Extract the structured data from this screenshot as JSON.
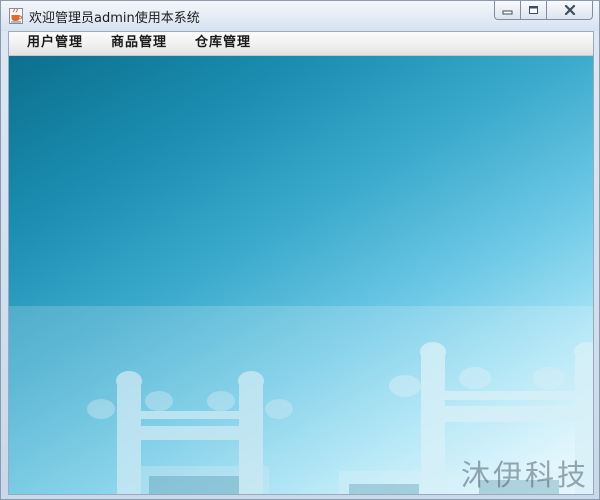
{
  "window": {
    "title": "欢迎管理员admin使用本系统",
    "icons": {
      "app": "java-coffee-icon",
      "minimize": "minimize-icon",
      "maximize": "maximize-icon",
      "close": "close-icon"
    }
  },
  "menubar": {
    "items": [
      {
        "label": "用户管理"
      },
      {
        "label": "商品管理"
      },
      {
        "label": "仓库管理"
      }
    ]
  },
  "background": {
    "watermark": "沐伊科技",
    "colors": {
      "top": "#0c6f8e",
      "middle": "#3aa9cc",
      "bottom": "#d8f3fb"
    }
  }
}
